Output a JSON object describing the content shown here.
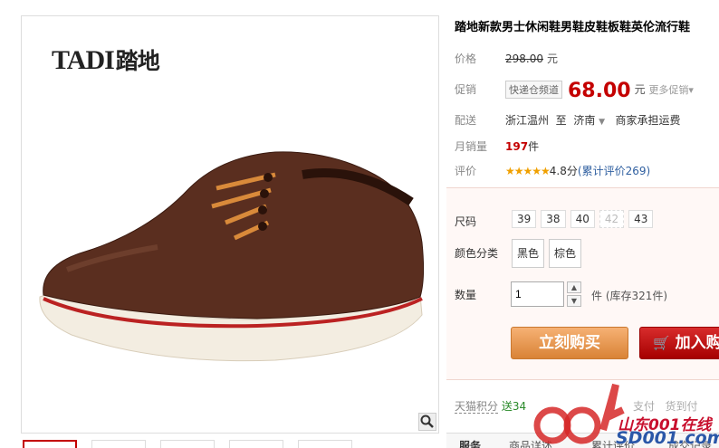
{
  "brand": {
    "latin": "TADI",
    "cn": "踏地"
  },
  "product": {
    "title": "踏地新款男士休闲鞋男鞋皮鞋板鞋英伦流行鞋"
  },
  "price": {
    "label": "价格",
    "original": "298.00",
    "unit": "元"
  },
  "promo": {
    "label": "促销",
    "tag": "快递仓频道",
    "price": "68.00",
    "unit": "元",
    "more": "更多促销▾"
  },
  "delivery": {
    "label": "配送",
    "from": "浙江温州",
    "to_word": "至",
    "to": "济南",
    "shipping": "商家承担运费"
  },
  "sales": {
    "label": "月销量",
    "count": "197",
    "unit": "件"
  },
  "rating": {
    "label": "评价",
    "stars": "★★★★★",
    "score": "4.8分",
    "total": "(累计评价269)"
  },
  "size": {
    "label": "尺码",
    "options": [
      "39",
      "38",
      "40",
      "42",
      "43"
    ]
  },
  "color": {
    "label": "颜色分类",
    "options": [
      "黑色",
      "棕色"
    ]
  },
  "quantity": {
    "label": "数量",
    "value": "1",
    "stock": "件 (库存321件)",
    "up": "▲",
    "down": "▼"
  },
  "buttons": {
    "buy": "立刻购买",
    "cart": "加入购"
  },
  "points": {
    "label": "天猫积分",
    "value": "送34"
  },
  "payment": {
    "text": "支付",
    "cod": "货到付"
  },
  "tabs": [
    "服务",
    "商品详述",
    "累计评价",
    "成交记录"
  ],
  "watermark": {
    "line1": "山东001在线",
    "line2": "SD001.com"
  },
  "colors": {
    "accent": "#c40000",
    "buy": "#e08a3b",
    "cart": "#b30000",
    "link": "#2f5fa0"
  }
}
